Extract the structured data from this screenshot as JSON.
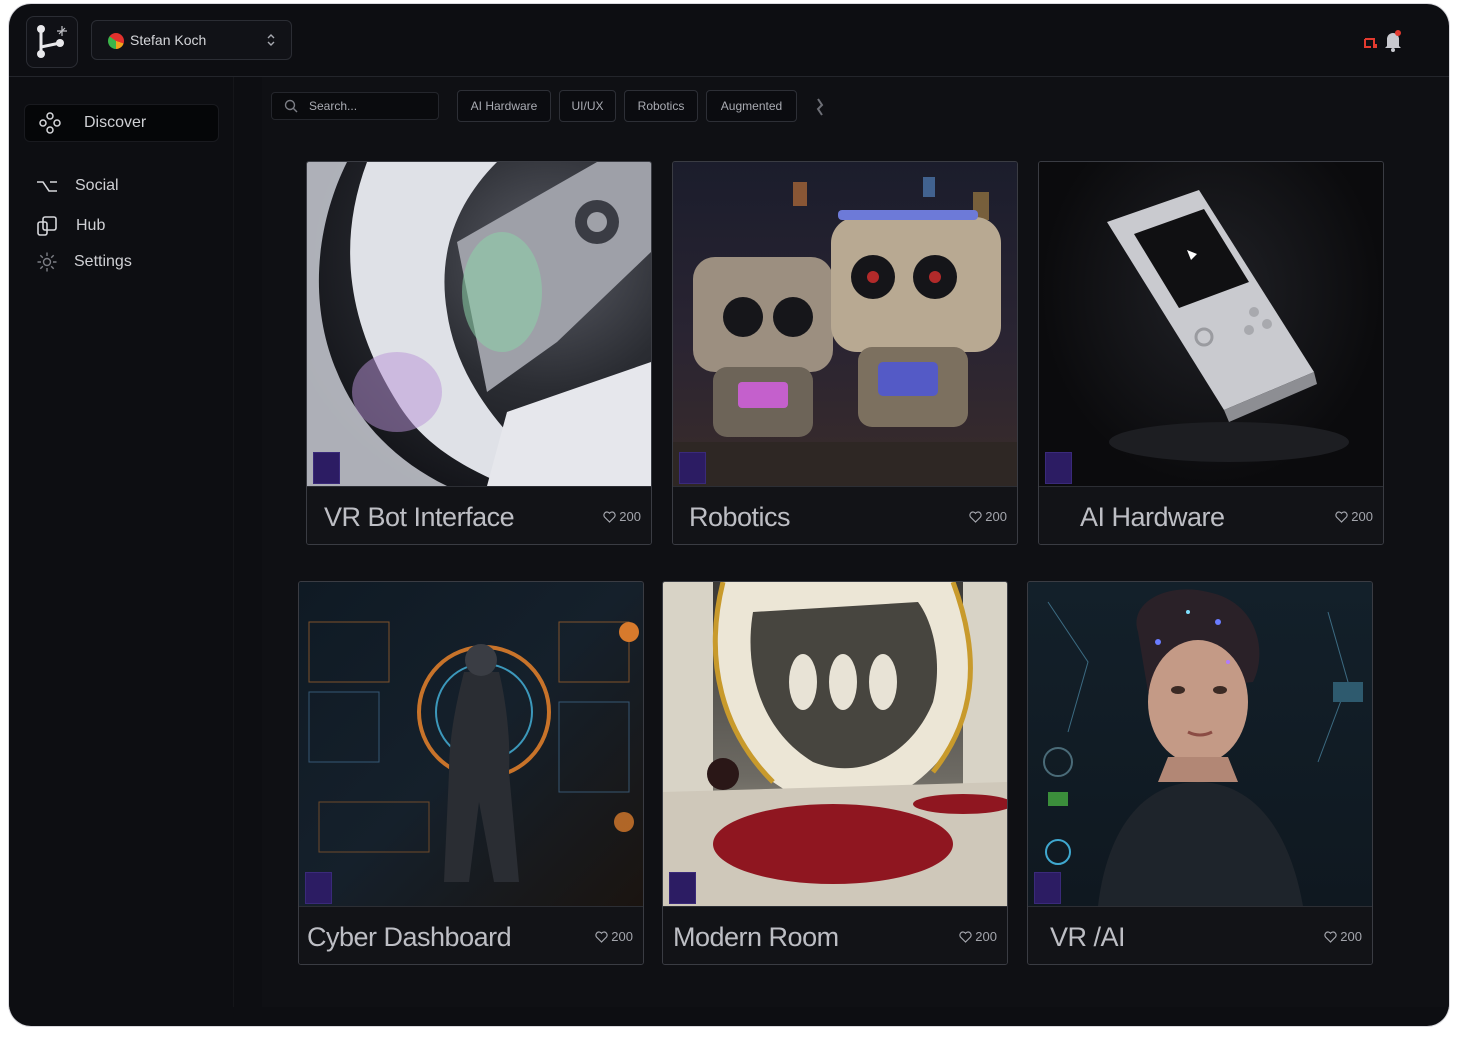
{
  "header": {
    "user_name": "Stefan Koch",
    "icons": [
      "logo-icon",
      "chevron-updown-icon",
      "screen-icon",
      "bell-icon"
    ]
  },
  "sidebar": {
    "items": [
      {
        "label": "Discover",
        "icon": "discover-icon",
        "active": true
      },
      {
        "label": "Social",
        "icon": "option-key-icon"
      },
      {
        "label": "Hub",
        "icon": "hub-icon"
      },
      {
        "label": "Settings",
        "icon": "gear-icon"
      }
    ]
  },
  "search": {
    "placeholder": "Search..."
  },
  "filters": [
    "AI Hardware",
    "UI/UX",
    "Robotics",
    "Augmented"
  ],
  "cards": [
    {
      "title": "VR Bot Interface",
      "likes": "200"
    },
    {
      "title": "Robotics",
      "likes": "200"
    },
    {
      "title": "AI Hardware",
      "likes": "200"
    },
    {
      "title": "Cyber Dashboard",
      "likes": "200"
    },
    {
      "title": "Modern Room",
      "likes": "200"
    },
    {
      "title": "VR /AI",
      "likes": "200"
    }
  ],
  "colors": {
    "background": "#0d0e12",
    "badge": "#2c1c63",
    "accent_red": "#e23a2f"
  }
}
